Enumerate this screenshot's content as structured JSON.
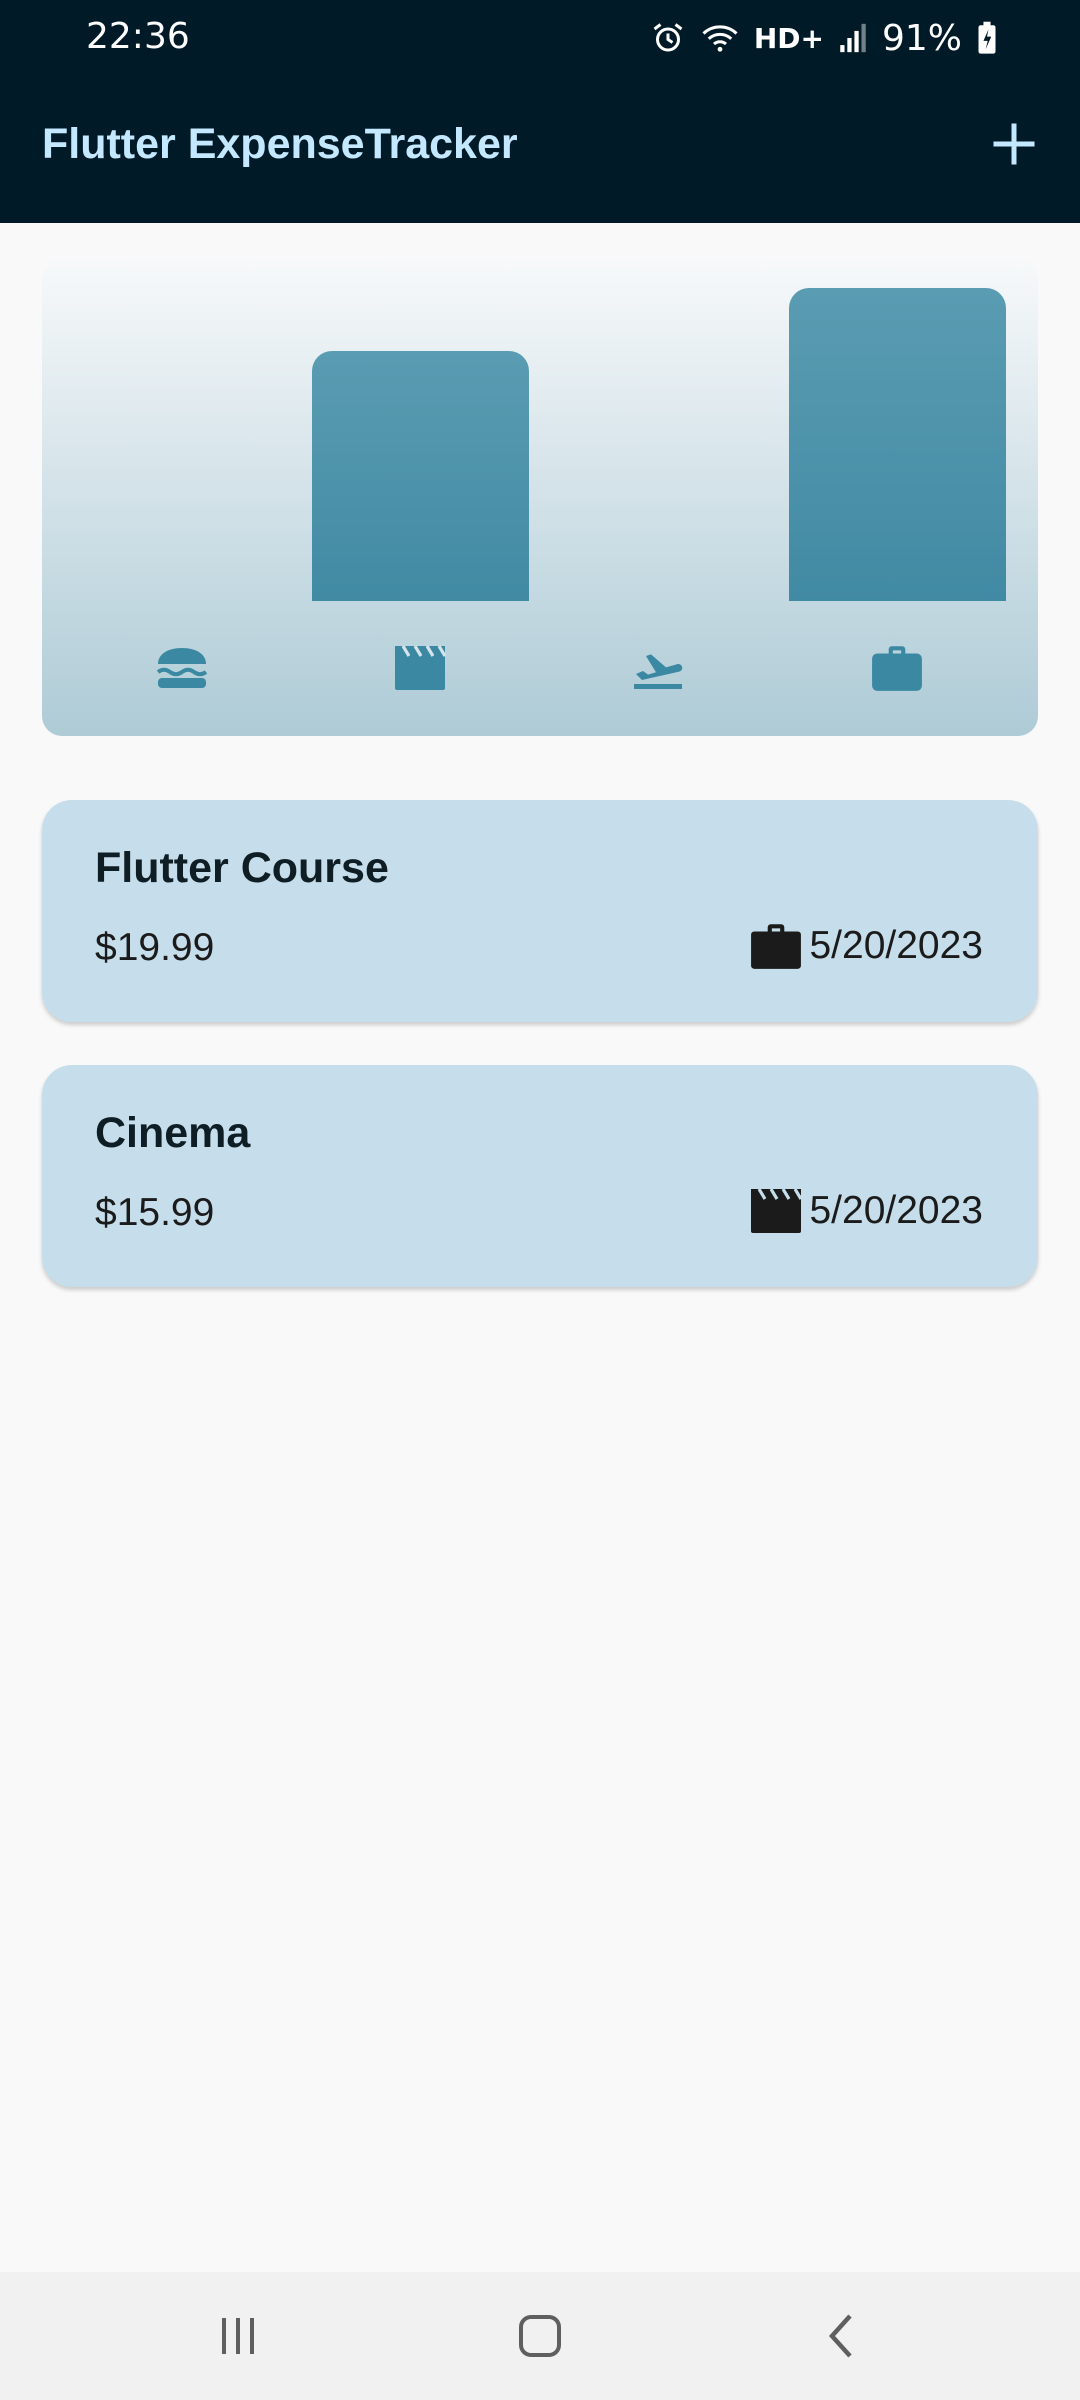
{
  "status_bar": {
    "time": "22:36",
    "network": "HD+",
    "battery": "91%"
  },
  "app_bar": {
    "title": "Flutter ExpenseTracker",
    "add_icon": "plus-icon"
  },
  "chart_data": {
    "type": "bar",
    "categories": [
      "food",
      "leisure",
      "travel",
      "work"
    ],
    "category_icons": [
      "hamburger-icon",
      "clapperboard-icon",
      "flight-takeoff-icon",
      "briefcase-icon"
    ],
    "values": [
      0,
      15.99,
      0,
      19.99
    ],
    "ylim": [
      0,
      19.99
    ]
  },
  "expenses": [
    {
      "title": "Flutter Course",
      "amount": "$19.99",
      "category_icon": "briefcase-icon",
      "date": "5/20/2023"
    },
    {
      "title": "Cinema",
      "amount": "$15.99",
      "category_icon": "clapperboard-icon",
      "date": "5/20/2023"
    }
  ],
  "nav_bar": {
    "items": [
      "recents-icon",
      "home-icon",
      "back-icon"
    ]
  },
  "colors": {
    "app_bar_bg": "#001b27",
    "title_color": "#c3e8ff",
    "bar_color": "#4a92aa",
    "card_bg": "#c6deeb",
    "icon_color": "#3b88a3"
  }
}
